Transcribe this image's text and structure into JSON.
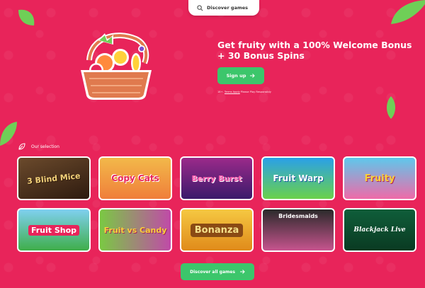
{
  "header": {
    "search_label": "Discover games",
    "search_icon": "search-icon"
  },
  "hero": {
    "title_line1": "Get fruity with a 100% Welcome Bonus",
    "title_line2": "+ 30 Bonus Spins",
    "signup_label": "Sign up",
    "terms_prefix": "18+.",
    "terms_link": "Terms Apply",
    "terms_suffix": "Please Play Responsibly"
  },
  "selection": {
    "title": "Our selection",
    "games": [
      {
        "name": "3 Blind Mice"
      },
      {
        "name": "Copy Cats"
      },
      {
        "name": "Berry Burst"
      },
      {
        "name": "Fruit Warp"
      },
      {
        "name": "Fruity"
      },
      {
        "name": "Fruit Shop"
      },
      {
        "name": "Fruit vs Candy"
      },
      {
        "name": "Bonanza"
      },
      {
        "name": "Bridesmaids"
      },
      {
        "name": "Blackjack Live"
      }
    ]
  },
  "footer": {
    "discover_all_label": "Discover all games"
  },
  "colors": {
    "background": "#e8245a",
    "button": "#3cc66b",
    "leaf": "#6fcf57"
  }
}
